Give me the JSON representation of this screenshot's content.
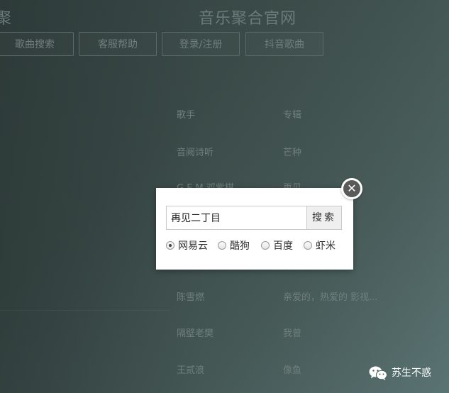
{
  "header": {
    "site_title": "音乐聚合官网",
    "left_cut_title": "聚"
  },
  "nav": {
    "items": [
      {
        "label": "歌曲搜索"
      },
      {
        "label": "客服帮助"
      },
      {
        "label": "登录/注册"
      },
      {
        "label": "抖音歌曲"
      }
    ]
  },
  "songs": {
    "header": {
      "singer": "歌手",
      "album": "专辑"
    },
    "rows": [
      {
        "singer": "音阙诗听",
        "album": "芒种"
      },
      {
        "singer": "G.E.M.邓紫棋",
        "album": "再见"
      },
      {
        "singer": "陈雪燃",
        "album": "亲爱的，热爱的 影视..."
      },
      {
        "singer": "隔壁老樊",
        "album": "我曾"
      },
      {
        "singer": "王贰浪",
        "album": "像鱼"
      }
    ]
  },
  "search_modal": {
    "input_value": "再见二丁目",
    "search_button": "搜索",
    "close_symbol": "✕",
    "sources": [
      {
        "label": "网易云",
        "checked": true
      },
      {
        "label": "酷狗",
        "checked": false
      },
      {
        "label": "百度",
        "checked": false
      },
      {
        "label": "虾米",
        "checked": false
      }
    ]
  },
  "watermark": {
    "text": "苏生不惑",
    "icon": "wechat-icon"
  }
}
